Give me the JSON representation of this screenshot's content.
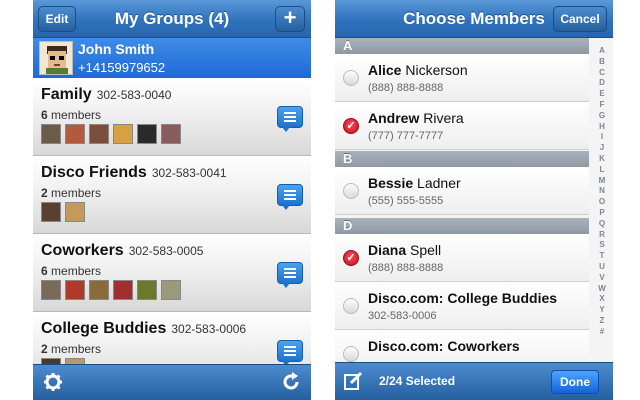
{
  "left": {
    "nav": {
      "title": "My Groups (4)",
      "edit": "Edit",
      "add": "+"
    },
    "user": {
      "name": "John Smith",
      "phone": "+14159979652"
    },
    "groups": [
      {
        "name": "Family",
        "phone": "302-583-0040",
        "count": "6",
        "members_label": "members"
      },
      {
        "name": "Disco Friends",
        "phone": "302-583-0041",
        "count": "2",
        "members_label": "members"
      },
      {
        "name": "Coworkers",
        "phone": "302-583-0005",
        "count": "6",
        "members_label": "members"
      },
      {
        "name": "College Buddies",
        "phone": "302-583-0006",
        "count": "2",
        "members_label": "members"
      }
    ],
    "toolbar": {
      "settings_icon": "gear-icon",
      "refresh_icon": "refresh-icon"
    }
  },
  "right": {
    "nav": {
      "title": "Choose Members",
      "cancel": "Cancel"
    },
    "sections": [
      "A",
      "B",
      "D"
    ],
    "contacts": [
      {
        "first": "Alice",
        "last": "Nickerson",
        "phone": "(888) 888-8888",
        "selected": false
      },
      {
        "first": "Andrew",
        "last": "Rivera",
        "phone": "(777) 777-7777",
        "selected": true
      },
      {
        "first": "Bessie",
        "last": "Ladner",
        "phone": "(555) 555-5555",
        "selected": false
      },
      {
        "first": "Diana",
        "last": "Spell",
        "phone": "(888) 888-8888",
        "selected": true
      },
      {
        "first": "Disco.com: College Buddies",
        "last": "",
        "phone": "302-583-0006",
        "selected": false
      },
      {
        "first": "Disco.com: Coworkers",
        "last": "",
        "phone": "",
        "selected": false
      }
    ],
    "index_letters": [
      "A",
      "B",
      "C",
      "D",
      "E",
      "F",
      "G",
      "H",
      "I",
      "J",
      "K",
      "L",
      "M",
      "N",
      "O",
      "P",
      "Q",
      "R",
      "S",
      "T",
      "U",
      "V",
      "W",
      "X",
      "Y",
      "Z",
      "#"
    ],
    "toolbar": {
      "selected_text": "2/24 Selected",
      "done": "Done"
    }
  },
  "colors": {
    "nav_blue": "#2f72bd",
    "selected_red": "#d21c2c",
    "user_row_blue": "#2a78de"
  }
}
